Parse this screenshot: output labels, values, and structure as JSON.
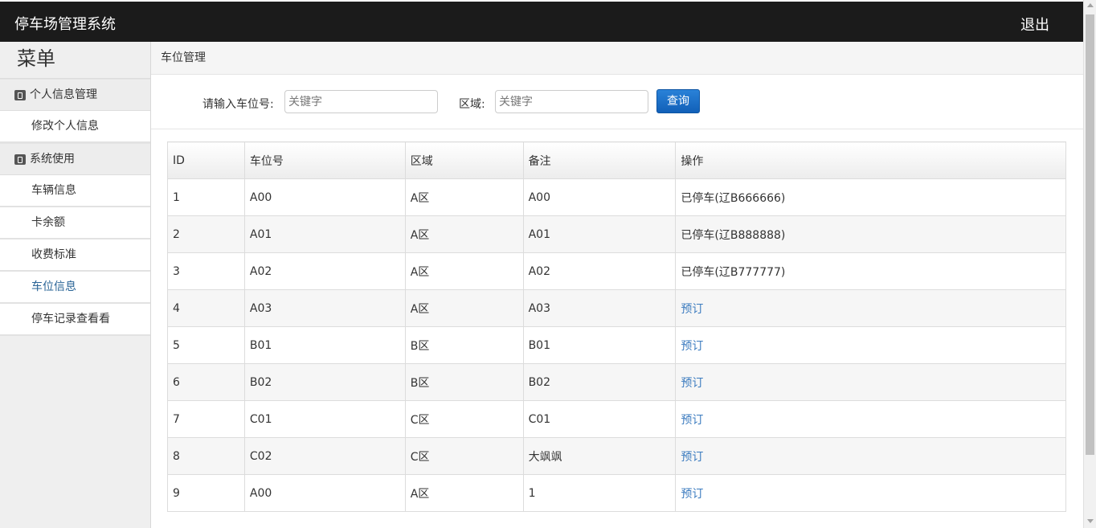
{
  "header": {
    "title": "停车场管理系统",
    "logout_label": "退出"
  },
  "sidebar": {
    "menu_title": "菜单",
    "groups": [
      {
        "label": "个人信息管理",
        "items": [
          "修改个人信息"
        ]
      },
      {
        "label": "系统使用",
        "items": [
          "车辆信息",
          "卡余额",
          "收费标准",
          "车位信息",
          "停车记录查看看"
        ]
      }
    ],
    "active_item": "车位信息"
  },
  "breadcrumb": "车位管理",
  "search": {
    "slot_label": "请输入车位号:",
    "slot_placeholder": "关键字",
    "area_label": "区域:",
    "area_placeholder": "关键字",
    "query_button": "查询"
  },
  "table": {
    "columns": [
      "ID",
      "车位号",
      "区域",
      "备注",
      "操作"
    ],
    "rows": [
      {
        "id": "1",
        "slot": "A00",
        "area": "A区",
        "note": "A00",
        "action": "已停车(辽B666666)",
        "action_is_link": false
      },
      {
        "id": "2",
        "slot": "A01",
        "area": "A区",
        "note": "A01",
        "action": "已停车(辽B888888)",
        "action_is_link": false
      },
      {
        "id": "3",
        "slot": "A02",
        "area": "A区",
        "note": "A02",
        "action": "已停车(辽B777777)",
        "action_is_link": false
      },
      {
        "id": "4",
        "slot": "A03",
        "area": "A区",
        "note": "A03",
        "action": "预订",
        "action_is_link": true
      },
      {
        "id": "5",
        "slot": "B01",
        "area": "B区",
        "note": "B01",
        "action": "预订",
        "action_is_link": true
      },
      {
        "id": "6",
        "slot": "B02",
        "area": "B区",
        "note": "B02",
        "action": "预订",
        "action_is_link": true
      },
      {
        "id": "7",
        "slot": "C01",
        "area": "C区",
        "note": "C01",
        "action": "预订",
        "action_is_link": true
      },
      {
        "id": "8",
        "slot": "C02",
        "area": "C区",
        "note": "大飒飒",
        "action": "预订",
        "action_is_link": true
      },
      {
        "id": "9",
        "slot": "A00",
        "area": "A区",
        "note": "1",
        "action": "预订",
        "action_is_link": true
      }
    ]
  },
  "colors": {
    "topbar": "#1b1b1b",
    "accent_button": "#1f6fc5",
    "link": "#3b7bbf",
    "active_menu": "#2a6496"
  },
  "icons": {
    "group_icon": "book-icon"
  }
}
